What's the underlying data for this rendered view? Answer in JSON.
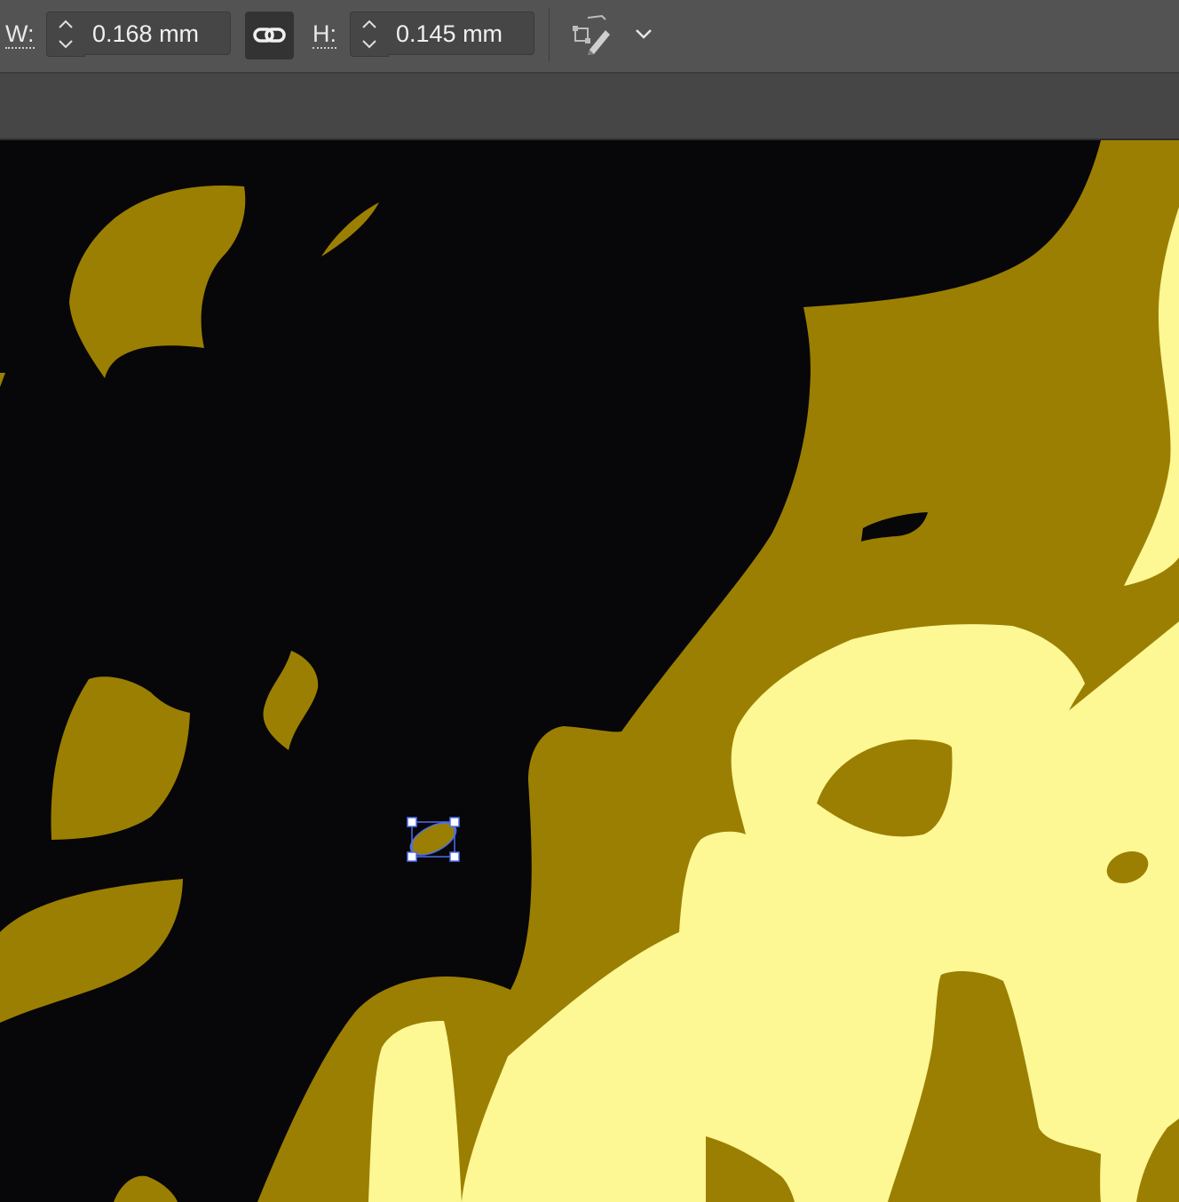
{
  "toolbar": {
    "width_label": "W:",
    "width_value": "0.168 mm",
    "height_label": "H:",
    "height_value": "0.145 mm",
    "link_icon": "link-icon",
    "edit_shape_icon": "shape-pencil-icon",
    "dropdown_icon": "chevron-down-icon"
  },
  "colors": {
    "background": "#070608",
    "dark_yellow": "#9b7f02",
    "light_yellow": "#fdf794",
    "selection": "#4a6ef0"
  }
}
